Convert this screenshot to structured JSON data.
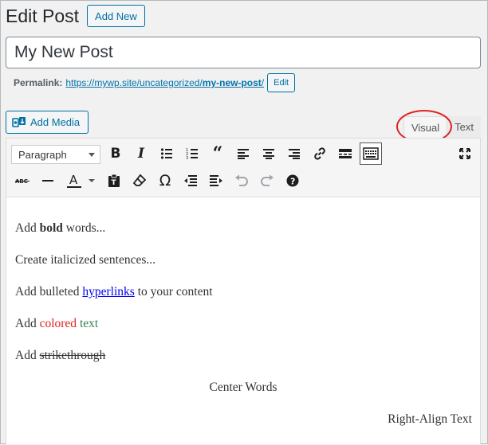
{
  "header": {
    "title": "Edit Post",
    "add_new_label": "Add New"
  },
  "post_title": {
    "value": "My New Post"
  },
  "permalink": {
    "label": "Permalink:",
    "url_prefix": "https://mywp.site/uncategorized/",
    "slug": "my-new-post",
    "url_suffix": "/",
    "edit_label": "Edit"
  },
  "media": {
    "add_media_label": "Add Media"
  },
  "editor_tabs": {
    "visual_label": "Visual",
    "text_label": "Text",
    "active": "visual"
  },
  "toolbar": {
    "format_select": "Paragraph",
    "row1": [
      "bold",
      "italic",
      "bulleted-list",
      "numbered-list",
      "blockquote",
      "align-left",
      "align-center",
      "align-right",
      "insert-link",
      "read-more",
      "toolbar-toggle",
      "fullscreen"
    ],
    "row2": [
      "strikethrough",
      "horizontal-line",
      "text-color",
      "paste-as-text",
      "clear-formatting",
      "special-character",
      "decrease-indent",
      "increase-indent",
      "undo",
      "redo",
      "keyboard-shortcuts"
    ]
  },
  "content": {
    "p1": {
      "before": "Add ",
      "bold": "bold",
      "after": " words..."
    },
    "p2": {
      "text": "Create italicized sentences..."
    },
    "p3": {
      "before": "Add bulleted ",
      "link": "hyperlinks",
      "after": " to your content"
    },
    "p4": {
      "before": "Add ",
      "red": "colored",
      "green": "text"
    },
    "p5": {
      "before": "Add ",
      "strike": "strikethrough"
    },
    "p6": {
      "text": "Center Words"
    },
    "p7": {
      "text": "Right-Align Text"
    }
  },
  "colors": {
    "accent": "#0071a1",
    "link": "#0073aa",
    "red_text": "#e02020",
    "green_text": "#35804e",
    "highlight_ring": "#e02020"
  }
}
